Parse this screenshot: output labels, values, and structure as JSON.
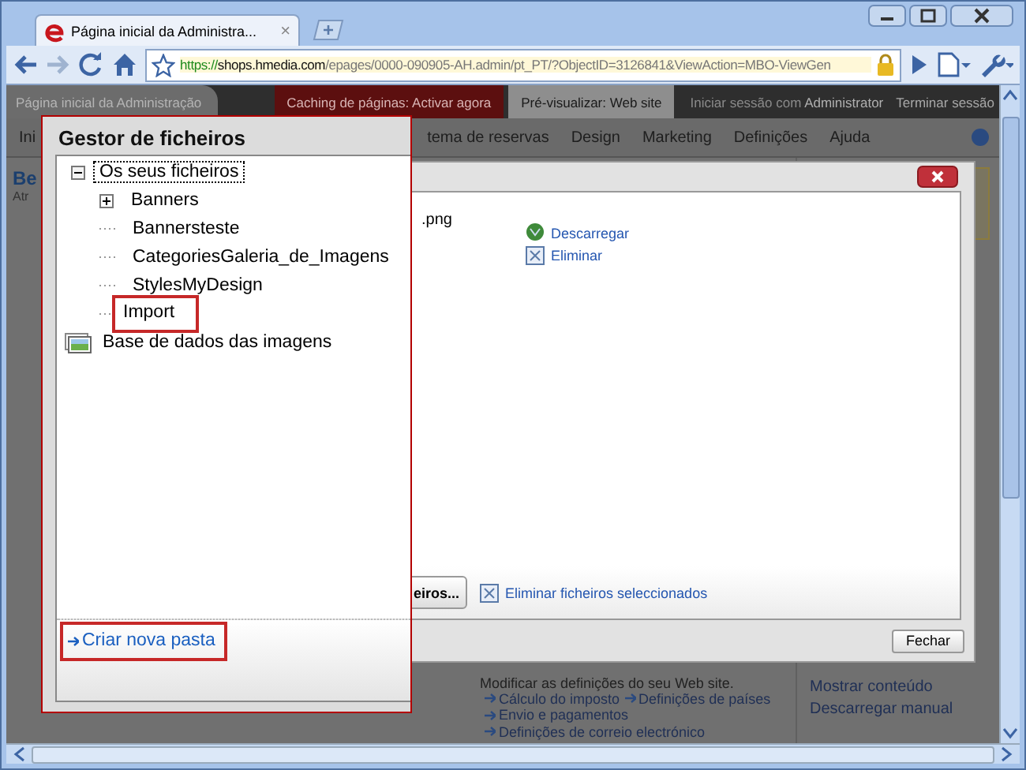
{
  "browser": {
    "tab_title": "Página inicial da Administra...",
    "tab_close": "×",
    "url": {
      "scheme": "https://",
      "host": "shops.hmedia.com",
      "path": "/epages/0000-090905-AH.admin/pt_PT/?ObjectID=3126841&ViewAction=MBO-ViewGen"
    }
  },
  "admin_bar": {
    "home_tab": "Página inicial da Administração",
    "caching_notice": "Caching de páginas: Activar agora",
    "preview_link": "Pré-visualizar: Web site",
    "session_label": "Iniciar sessão com",
    "session_user": "Administrator",
    "logout_link": "Terminar sessão"
  },
  "nav_menu": [
    {
      "label": "Ini"
    },
    {
      "label": "tema de reservas"
    },
    {
      "label": "Design"
    },
    {
      "label": "Marketing"
    },
    {
      "label": "Definições"
    },
    {
      "label": "Ajuda"
    }
  ],
  "page": {
    "heading": "Be",
    "subheading": "Atr",
    "settings_text": "Modificar as definições do seu Web site.",
    "settings_links": [
      "Cálculo do imposto",
      "Definições de países",
      "Envio e pagamentos",
      "Definições de correio electrónico"
    ],
    "side_links": [
      "Mostrar conteúdo",
      "Descarregar manual"
    ]
  },
  "file_dialog": {
    "file_name": ".png",
    "actions": [
      {
        "kind": "download",
        "label": "Descarregar"
      },
      {
        "kind": "delete",
        "label": "Eliminar"
      }
    ],
    "upload_button": "eiros...",
    "delete_selected": "Eliminar ficheiros seleccionados",
    "close_button": "Fechar"
  },
  "file_manager": {
    "title": "Gestor de ficheiros",
    "tree": [
      {
        "label": "Os seus ficheiros",
        "kind": "branch",
        "expanded": true,
        "selected": true,
        "highlighted": false,
        "children": [
          {
            "label": "Banners",
            "kind": "branch",
            "expanded": false,
            "selected": false,
            "highlighted": false
          },
          {
            "label": "Bannersteste",
            "kind": "leaf",
            "selected": false,
            "highlighted": false
          },
          {
            "label": "CategoriesGaleria_de_Imagens",
            "kind": "leaf",
            "selected": false,
            "highlighted": false
          },
          {
            "label": "StylesMyDesign",
            "kind": "leaf",
            "selected": false,
            "highlighted": false
          },
          {
            "label": "Import",
            "kind": "leaf",
            "selected": false,
            "highlighted": true
          }
        ]
      },
      {
        "label": "Base de dados das imagens",
        "kind": "image-db",
        "selected": false,
        "highlighted": false
      }
    ],
    "new_folder_link": {
      "label": "Criar nova pasta",
      "highlighted": true
    }
  }
}
